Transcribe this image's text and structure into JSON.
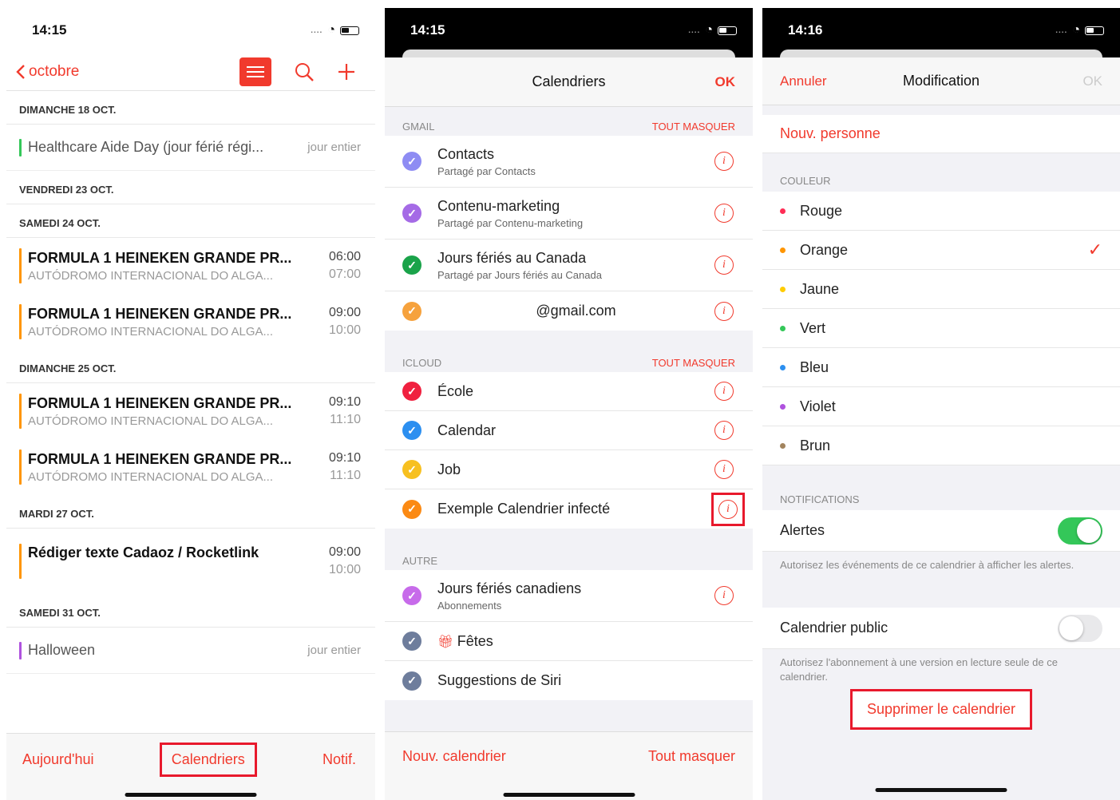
{
  "panel1": {
    "time": "14:15",
    "back_label": "octobre",
    "days": [
      {
        "header": "DIMANCHE 18 OCT.",
        "items": [
          {
            "kind": "allday",
            "title": "Healthcare Aide Day (jour férié régi...",
            "when": "jour entier",
            "color": "#34c759"
          }
        ]
      },
      {
        "header": "VENDREDI 23 OCT.",
        "items": []
      },
      {
        "header": "SAMEDI 24 OCT.",
        "items": [
          {
            "kind": "evt",
            "title": "FORMULA 1 HEINEKEN GRANDE PR...",
            "loc": "AUTÓDROMO INTERNACIONAL DO ALGA...",
            "t1": "06:00",
            "t2": "07:00",
            "color": "#ff9500"
          },
          {
            "kind": "evt",
            "title": "FORMULA 1 HEINEKEN GRANDE PR...",
            "loc": "AUTÓDROMO INTERNACIONAL DO ALGA...",
            "t1": "09:00",
            "t2": "10:00",
            "color": "#ff9500"
          }
        ]
      },
      {
        "header": "DIMANCHE 25 OCT.",
        "items": [
          {
            "kind": "evt",
            "title": "FORMULA 1 HEINEKEN GRANDE PR...",
            "loc": "AUTÓDROMO INTERNACIONAL DO ALGA...",
            "t1": "09:10",
            "t2": "11:10",
            "color": "#ff9500"
          },
          {
            "kind": "evt",
            "title": "FORMULA 1 HEINEKEN GRANDE PR...",
            "loc": "AUTÓDROMO INTERNACIONAL DO ALGA...",
            "t1": "09:10",
            "t2": "11:10",
            "color": "#ff9500"
          }
        ]
      },
      {
        "header": "MARDI 27 OCT.",
        "items": [
          {
            "kind": "evt",
            "title": "Rédiger texte Cadaoz / Rocketlink",
            "loc": "",
            "t1": "09:00",
            "t2": "10:00",
            "color": "#ff9500"
          }
        ]
      },
      {
        "header": "SAMEDI 31 OCT.",
        "items": [
          {
            "kind": "allday",
            "title": "Halloween",
            "when": "jour entier",
            "color": "#af52de"
          }
        ]
      }
    ],
    "toolbar": {
      "today": "Aujourd'hui",
      "calendars": "Calendriers",
      "notif": "Notif."
    }
  },
  "panel2": {
    "time": "14:15",
    "title": "Calendriers",
    "ok": "OK",
    "sections": [
      {
        "name": "GMAIL",
        "action": "TOUT MASQUER",
        "rows": [
          {
            "name": "Contacts",
            "sub": "Partagé par Contacts",
            "color": "#8e8cf3"
          },
          {
            "name": "Contenu-marketing",
            "sub": "Partagé par Contenu-marketing",
            "color": "#a56be6"
          },
          {
            "name": "Jours fériés au Canada",
            "sub": "Partagé par Jours fériés au Canada",
            "color": "#1aa34a"
          },
          {
            "name": "@gmail.com",
            "sub": "",
            "color": "#f6a23d",
            "center": true
          }
        ]
      },
      {
        "name": "ICLOUD",
        "action": "TOUT MASQUER",
        "rows": [
          {
            "name": "École",
            "sub": "",
            "color": "#f0203f"
          },
          {
            "name": "Calendar",
            "sub": "",
            "color": "#2c8ff0"
          },
          {
            "name": "Job",
            "sub": "",
            "color": "#f7c020"
          },
          {
            "name": "Exemple Calendrier infecté",
            "sub": "",
            "color": "#fb8a14",
            "highlight": true
          }
        ]
      },
      {
        "name": "AUTRE",
        "action": "",
        "rows": [
          {
            "name": "Jours fériés canadiens",
            "sub": "Abonnements",
            "color": "#c76bea"
          },
          {
            "name": "Fêtes",
            "sub": "",
            "color": "#6e7d9c",
            "gift": true,
            "noinfo": true
          },
          {
            "name": "Suggestions de Siri",
            "sub": "",
            "color": "#6e7d9c",
            "noinfo": true
          }
        ]
      }
    ],
    "footer": {
      "new": "Nouv. calendrier",
      "hide": "Tout masquer"
    }
  },
  "panel3": {
    "time": "14:16",
    "cancel": "Annuler",
    "title": "Modification",
    "ok": "OK",
    "new_person": "Nouv. personne",
    "color_header": "COULEUR",
    "colors": [
      {
        "name": "Rouge",
        "hex": "#ff2d55"
      },
      {
        "name": "Orange",
        "hex": "#ff9500",
        "selected": true
      },
      {
        "name": "Jaune",
        "hex": "#ffcc00"
      },
      {
        "name": "Vert",
        "hex": "#34c759"
      },
      {
        "name": "Bleu",
        "hex": "#2c8ff0"
      },
      {
        "name": "Violet",
        "hex": "#af52de"
      },
      {
        "name": "Brun",
        "hex": "#a2845e"
      }
    ],
    "notif_header": "NOTIFICATIONS",
    "alerts_label": "Alertes",
    "alerts_on": true,
    "alerts_note": "Autorisez les événements de ce calendrier à afficher les alertes.",
    "public_label": "Calendrier public",
    "public_on": false,
    "public_note": "Autorisez l'abonnement à une version en lecture seule de ce calendrier.",
    "delete": "Supprimer le calendrier"
  }
}
